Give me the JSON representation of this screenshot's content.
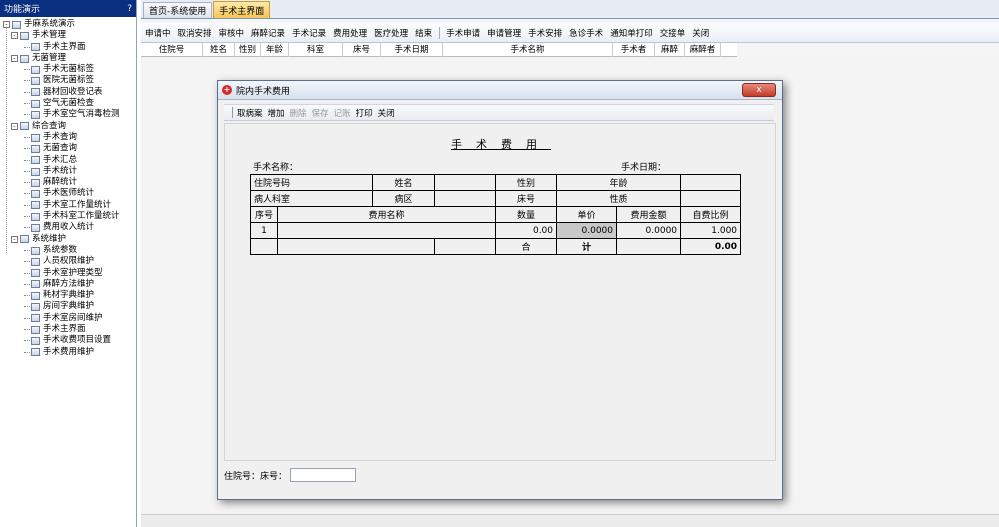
{
  "left_panel": {
    "title": "功能演示",
    "pin": "?",
    "root": "手麻系统演示",
    "groups": [
      {
        "label": "手术管理",
        "items": [
          "手术主界面"
        ]
      },
      {
        "label": "无菌管理",
        "items": [
          "手术无菌标签",
          "医院无菌标签",
          "器材回收登记表",
          "空气无菌检查",
          "手术室空气消毒检测"
        ]
      },
      {
        "label": "综合查询",
        "items": [
          "手术查询",
          "无菌查询",
          "手术汇总",
          "手术统计",
          "麻醉统计",
          "手术医师统计",
          "手术室工作量统计",
          "手术科室工作量统计",
          "费用收入统计"
        ]
      },
      {
        "label": "系统维护",
        "items": [
          "系统参数",
          "人员权限维护",
          "手术室护理类型",
          "麻醉方法维护",
          "耗材字典维护",
          "房间字典维护",
          "手术室房间维护",
          "手术主界面",
          "手术收费项目设置",
          "手术费用维护"
        ]
      }
    ]
  },
  "tabs": [
    {
      "label": "首页-系统使用"
    },
    {
      "label": "手术主界面"
    }
  ],
  "toolbar": {
    "group1": [
      "申请中",
      "取消安排",
      "审核中",
      "麻醉记录",
      "手术记录",
      "费用处理",
      "医疗处理",
      "结束"
    ],
    "group2": [
      "手术申请",
      "申请管理",
      "手术安排",
      "急诊手术",
      "通知单打印",
      "交接单",
      "关闭"
    ]
  },
  "grid_headers": [
    "住院号",
    "姓名",
    "性别",
    "年龄",
    "科室",
    "床号",
    "手术日期",
    "手术名称",
    "手术者",
    "麻醉",
    "麻醉者"
  ],
  "dialog": {
    "title": "院内手术费用",
    "close": "x",
    "toolbar": [
      "取病案",
      "增加",
      "删除",
      "保存",
      "记账",
      "打印",
      "关闭"
    ],
    "toolbar_disabled": [
      "删除",
      "保存",
      "记账"
    ],
    "doc_title": "手术费用",
    "surgery_name_label": "手术名称：",
    "surgery_date_label": "手术日期：",
    "row1": {
      "inpatient_label": "住院号码",
      "name_label": "姓名",
      "sex_label": "性别",
      "age_label": "年龄"
    },
    "row2": {
      "admit_label": "病人科室",
      "ward_label": "病区",
      "bed_label": "床号",
      "nature_label": "性质"
    },
    "cols": {
      "seq": "序号",
      "fee_name": "费用名称",
      "qty": "数量",
      "price": "单价",
      "amount": "费用金额",
      "self_ratio": "自费比例"
    },
    "row_item": {
      "seq": "1",
      "qty": "0.00",
      "price": "0.0000",
      "amount": "0.0000",
      "self_ratio": "1.000"
    },
    "total": {
      "he": "合",
      "ji": "计",
      "value": "0.00"
    },
    "bottom_label": "住院号：床号："
  }
}
